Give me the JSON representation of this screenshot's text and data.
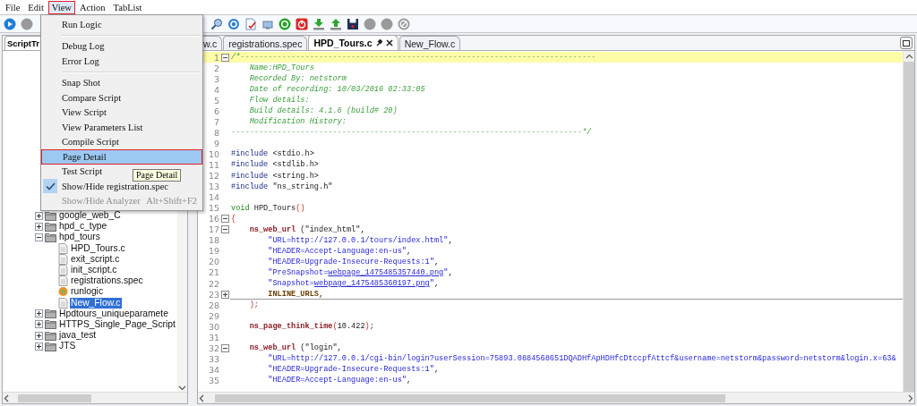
{
  "menubar": [
    {
      "label": "File",
      "selected": false
    },
    {
      "label": "Edit",
      "selected": false
    },
    {
      "label": "View",
      "selected": true
    },
    {
      "label": "Action",
      "selected": false
    },
    {
      "label": "TabList",
      "selected": false
    }
  ],
  "view_menu": {
    "items": [
      {
        "kind": "item",
        "label": "Run Logic",
        "selected": false,
        "checked": false,
        "disabled": false
      },
      {
        "kind": "separator"
      },
      {
        "kind": "item",
        "label": "Debug Log",
        "selected": false,
        "checked": false,
        "disabled": false
      },
      {
        "kind": "item",
        "label": "Error Log",
        "selected": false,
        "checked": false,
        "disabled": false
      },
      {
        "kind": "separator"
      },
      {
        "kind": "item",
        "label": "Snap Shot",
        "selected": false,
        "checked": false,
        "disabled": false
      },
      {
        "kind": "item",
        "label": "Compare Script",
        "selected": false,
        "checked": false,
        "disabled": false
      },
      {
        "kind": "item",
        "label": "View Script",
        "selected": false,
        "checked": false,
        "disabled": false
      },
      {
        "kind": "item",
        "label": "View Parameters List",
        "selected": false,
        "checked": false,
        "disabled": false
      },
      {
        "kind": "item",
        "label": "Compile Script",
        "selected": false,
        "checked": false,
        "disabled": false
      },
      {
        "kind": "item",
        "label": "Page Detail",
        "selected": true,
        "checked": false,
        "disabled": false
      },
      {
        "kind": "item",
        "label": "Test Script",
        "selected": false,
        "checked": false,
        "disabled": false
      },
      {
        "kind": "item",
        "label": "Show/Hide registration.spec",
        "selected": false,
        "checked": true,
        "disabled": false
      },
      {
        "kind": "item",
        "label": "Show/Hide Analyzer",
        "shortcut": "Alt+Shift+F2",
        "selected": false,
        "checked": false,
        "disabled": true
      }
    ]
  },
  "tooltip": "Page Detail",
  "left_panel": {
    "tab": "ScriptTr",
    "tree": [
      {
        "label": "google_web_C",
        "kind": "folder",
        "expanded": false,
        "selected": false
      },
      {
        "label": "hpd_c_type",
        "kind": "folder",
        "expanded": false,
        "selected": false
      },
      {
        "label": "hpd_tours",
        "kind": "folder",
        "expanded": true,
        "selected": false,
        "children": [
          {
            "label": "HPD_Tours.c",
            "kind": "file",
            "selected": false
          },
          {
            "label": "exit_script.c",
            "kind": "file",
            "selected": false
          },
          {
            "label": "init_script.c",
            "kind": "file",
            "selected": false
          },
          {
            "label": "registrations.spec",
            "kind": "file",
            "selected": false
          },
          {
            "label": "runlogic",
            "kind": "logic",
            "selected": false
          },
          {
            "label": "New_Flow.c",
            "kind": "file",
            "selected": true
          }
        ]
      },
      {
        "label": "Hpdtours_uniqueparamete",
        "kind": "folder",
        "expanded": false,
        "selected": false
      },
      {
        "label": "HTTPS_Single_Page_Script",
        "kind": "folder",
        "expanded": false,
        "selected": false
      },
      {
        "label": "java_test",
        "kind": "folder",
        "expanded": false,
        "selected": false
      },
      {
        "label": "JTS",
        "kind": "folder",
        "expanded": false,
        "selected": false
      }
    ]
  },
  "editor": {
    "tabs": [
      {
        "label": "w.c",
        "selected": false
      },
      {
        "label": "registrations.spec",
        "selected": false
      },
      {
        "label": "HPD_Tours.c",
        "selected": true
      },
      {
        "label": "New_Flow.c",
        "selected": false
      }
    ],
    "lines": [
      {
        "number": "1",
        "highlighted": true,
        "collapsed": false,
        "segments": [
          {
            "kind": "comment",
            "text": "/*-----------------------------------------------------------------------------"
          }
        ]
      },
      {
        "number": "2",
        "highlighted": false,
        "segments": [
          {
            "kind": "comment",
            "text": "    Name:HPD_Tours"
          }
        ]
      },
      {
        "number": "3",
        "highlighted": false,
        "segments": [
          {
            "kind": "comment",
            "text": "    Recorded By: netstorm"
          }
        ]
      },
      {
        "number": "4",
        "highlighted": false,
        "segments": [
          {
            "kind": "comment",
            "text": "    Date of recording: 10/03/2016 02:33:05"
          }
        ]
      },
      {
        "number": "5",
        "highlighted": false,
        "segments": [
          {
            "kind": "comment",
            "text": "    Flow details:"
          }
        ]
      },
      {
        "number": "6",
        "highlighted": false,
        "segments": [
          {
            "kind": "comment",
            "text": "    Build details: 4.1.6 (build# 20)"
          }
        ]
      },
      {
        "number": "7",
        "highlighted": false,
        "segments": [
          {
            "kind": "comment",
            "text": "    Modification History:"
          }
        ]
      },
      {
        "number": "8",
        "highlighted": false,
        "segments": [
          {
            "kind": "comment",
            "text": "----------------------------------------------------------------------------*/"
          }
        ]
      },
      {
        "number": "9",
        "highlighted": false
      },
      {
        "number": "10",
        "highlighted": false,
        "segments": [
          {
            "kind": "keyword",
            "text": "#include"
          },
          {
            "kind": "plain",
            "text": " <stdio.h>"
          }
        ]
      },
      {
        "number": "11",
        "highlighted": false,
        "segments": [
          {
            "kind": "keyword",
            "text": "#include"
          },
          {
            "kind": "plain",
            "text": " <stdlib.h>"
          }
        ]
      },
      {
        "number": "12",
        "highlighted": false,
        "segments": [
          {
            "kind": "keyword",
            "text": "#include"
          },
          {
            "kind": "plain",
            "text": " <string.h>"
          }
        ]
      },
      {
        "number": "13",
        "highlighted": false,
        "segments": [
          {
            "kind": "keyword",
            "text": "#include"
          },
          {
            "kind": "plain",
            "text": " \"ns_string.h\""
          }
        ]
      },
      {
        "number": "14",
        "highlighted": false
      },
      {
        "number": "15",
        "highlighted": false,
        "segments": [
          {
            "kind": "type",
            "text": "void"
          },
          {
            "kind": "plain",
            "text": " HPD_Tours"
          },
          {
            "kind": "paren",
            "text": "()"
          }
        ]
      },
      {
        "number": "16",
        "highlighted": false,
        "collapsed": false,
        "segments": [
          {
            "kind": "paren",
            "text": "{"
          }
        ]
      },
      {
        "number": "17",
        "highlighted": false,
        "collapsed": false,
        "segments": [
          {
            "kind": "func",
            "text": "    ns_web_url"
          },
          {
            "kind": "plain",
            "text": " (\"index_html\","
          }
        ]
      },
      {
        "number": "18",
        "highlighted": false,
        "segments": [
          {
            "kind": "string",
            "text": "        \"URL=http://127.0.0.1/tours/index.html\""
          },
          {
            "kind": "plain",
            "text": ","
          }
        ]
      },
      {
        "number": "19",
        "highlighted": false,
        "segments": [
          {
            "kind": "string",
            "text": "        \"HEADER=Accept-Language:en-us\""
          },
          {
            "kind": "plain",
            "text": ","
          }
        ]
      },
      {
        "number": "20",
        "highlighted": false,
        "segments": [
          {
            "kind": "string",
            "text": "        \"HEADER=Upgrade-Insecure-Requests:1\""
          },
          {
            "kind": "plain",
            "text": ","
          }
        ]
      },
      {
        "number": "21",
        "highlighted": false,
        "segments": [
          {
            "kind": "string",
            "text": "        \"PreSnapshot="
          },
          {
            "kind": "link",
            "text": "webpage_1475485357440.png"
          },
          {
            "kind": "string",
            "text": "\""
          },
          {
            "kind": "plain",
            "text": ","
          }
        ]
      },
      {
        "number": "22",
        "highlighted": false,
        "segments": [
          {
            "kind": "string",
            "text": "        \"Snapshot="
          },
          {
            "kind": "link",
            "text": "webpage_1475485360197.png"
          },
          {
            "kind": "string",
            "text": "\""
          },
          {
            "kind": "plain",
            "text": ","
          }
        ]
      },
      {
        "number": "23",
        "highlighted": false,
        "collapsed": true,
        "segments": [
          {
            "kind": "constant",
            "text": "        INLINE_URLS,"
          }
        ]
      },
      {
        "number": "28",
        "highlighted": false,
        "segments": [
          {
            "kind": "paren",
            "text": "    );"
          }
        ]
      },
      {
        "number": "29",
        "highlighted": false
      },
      {
        "number": "30",
        "highlighted": false,
        "segments": [
          {
            "kind": "func",
            "text": "    ns_page_think_time"
          },
          {
            "kind": "paren",
            "text": "("
          },
          {
            "kind": "plain",
            "text": "10.422"
          },
          {
            "kind": "paren",
            "text": ")"
          },
          {
            "kind": "plain",
            "text": ";"
          }
        ]
      },
      {
        "number": "31",
        "highlighted": false
      },
      {
        "number": "32",
        "highlighted": false,
        "collapsed": false,
        "segments": [
          {
            "kind": "func",
            "text": "    ns_web_url"
          },
          {
            "kind": "plain",
            "text": " (\"login\","
          }
        ]
      },
      {
        "number": "33",
        "highlighted": false,
        "segments": [
          {
            "kind": "string",
            "text": "        \"URL=http://127.0.0.1/cgi-bin/login?userSession=75893.0884568651DQADHfApHDHfcDtccpfAttcf&username=netstorm&password=netstorm&login.x=63&"
          }
        ]
      },
      {
        "number": "34",
        "highlighted": false,
        "segments": [
          {
            "kind": "string",
            "text": "        \"HEADER=Upgrade-Insecure-Requests:1\""
          },
          {
            "kind": "plain",
            "text": ","
          }
        ]
      },
      {
        "number": "35",
        "highlighted": false,
        "segments": [
          {
            "kind": "string",
            "text": "        \"HEADER=Accept-Language:en-us\""
          },
          {
            "kind": "plain",
            "text": ","
          }
        ]
      }
    ]
  }
}
